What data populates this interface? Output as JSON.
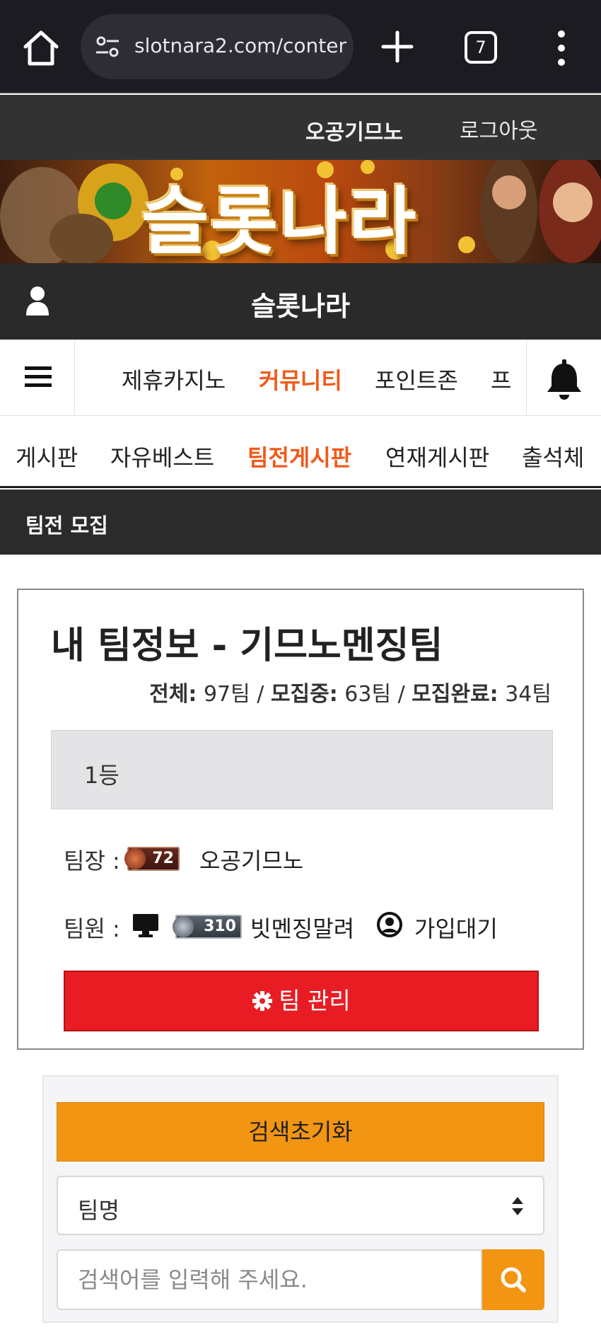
{
  "browser": {
    "url": "slotnara2.com/conten",
    "tab_count": "7"
  },
  "site_top": {
    "user_name": "오공기므노",
    "logout": "로그아웃"
  },
  "banner": {
    "title": "슬롯나라"
  },
  "site_title": "슬롯나라",
  "main_nav": {
    "items": [
      "제휴카지노",
      "커뮤니티",
      "포인트존",
      "프"
    ],
    "active_index": 1
  },
  "sub_nav": {
    "items": [
      "게시판",
      "자유베스트",
      "팀전게시판",
      "연재게시판",
      "출석체"
    ],
    "active_index": 2
  },
  "section_title": "팀전 모집",
  "team_card": {
    "title": "내 팀정보 - 기므노멘징팀",
    "stats": {
      "total_label": "전체:",
      "total_value": "97팀",
      "recruiting_label": "모집중:",
      "recruiting_value": "63팀",
      "done_label": "모집완료:",
      "done_value": "34팀",
      "separator": " / "
    },
    "rank": "1등",
    "leader_label": "팀장 :",
    "leader_level": "72",
    "leader_name": "오공기므노",
    "member_label": "팀원 :",
    "member_level": "310",
    "member_name": "빗멘징말려",
    "pending_label": "가입대기",
    "manage_button": "팀 관리"
  },
  "search_panel": {
    "reset_button": "검색초기화",
    "select_value": "팀명",
    "search_placeholder": "검색어를 입력해 주세요."
  },
  "colors": {
    "accent_orange": "#f05a1a",
    "button_orange": "#f29513",
    "button_red": "#e81c22",
    "dark_bar": "#2b2b2b"
  }
}
